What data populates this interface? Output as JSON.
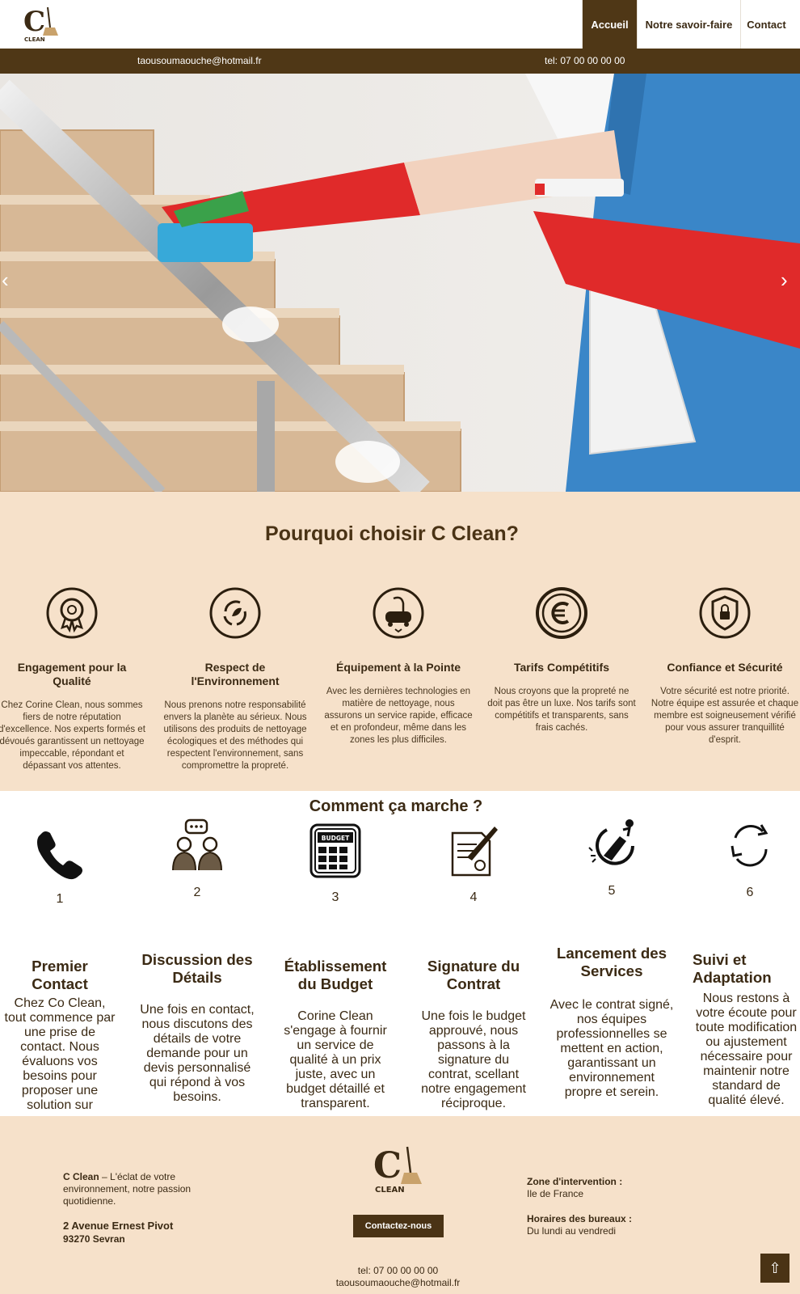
{
  "header": {
    "logo_text": "CLEAN",
    "nav": [
      {
        "label": "Accueil",
        "active": true
      },
      {
        "label": "Notre savoir-faire",
        "active": false
      },
      {
        "label": "Contact",
        "active": false
      }
    ],
    "email": "taousoumaouche@hotmail.fr",
    "phone": "tel: 07 00 00 00 00"
  },
  "hero": {
    "prev_arrow": "‹",
    "next_arrow": "›"
  },
  "why": {
    "title": "Pourquoi choisir C Clean?",
    "features": [
      {
        "icon": "award-medal-icon",
        "title": "Engagement pour la Qualité",
        "text": "Chez Corine Clean, nous sommes fiers de notre réputation d'excellence. Nos experts formés et dévoués garantissent un nettoyage impeccable, répondant et dépassant vos attentes."
      },
      {
        "icon": "recycle-leaf-icon",
        "title": "Respect de l'Environnement",
        "text": "Nous prenons notre responsabilité envers la planète au sérieux. Nous utilisons des produits de nettoyage écologiques et des méthodes qui respectent l'environnement, sans compromettre la propreté."
      },
      {
        "icon": "vacuum-cleaner-icon",
        "title": "Équipement à la Pointe",
        "text": "Avec les dernières technologies en matière de nettoyage, nous assurons un service rapide, efficace et en profondeur, même dans les zones les plus difficiles."
      },
      {
        "icon": "euro-coin-icon",
        "title": "Tarifs Compétitifs",
        "text": "Nous croyons que la propreté ne doit pas être un luxe. Nos tarifs sont compétitifs et transparents, sans frais cachés."
      },
      {
        "icon": "shield-lock-icon",
        "title": "Confiance et Sécurité",
        "text": "Votre sécurité est notre priorité. Notre équipe est assurée et chaque membre est soigneusement vérifié pour vous assurer tranquillité d'esprit."
      }
    ]
  },
  "how": {
    "title": "Comment ça marche ?",
    "steps": [
      {
        "icon": "phone-icon",
        "num": "1",
        "title": "Premier Contact",
        "text": "Chez Co Clean, tout commence par une prise de contact. Nous évaluons vos besoins pour proposer une solution sur mesure."
      },
      {
        "icon": "discussion-icon",
        "num": "2",
        "title": "Discussion des Détails",
        "text": "Une fois en contact, nous discutons des détails de votre demande pour un devis personnalisé qui répond à vos besoins."
      },
      {
        "icon": "budget-calculator-icon",
        "num": "3",
        "title": "Établissement du Budget",
        "text": "Corine Clean s'engage à fournir un service de qualité à un prix juste, avec un budget détaillé et transparent.",
        "icon_text": "BUDGET"
      },
      {
        "icon": "contract-signature-icon",
        "num": "4",
        "title": "Signature du Contrat",
        "text": "Une fois le budget approuvé, nous passons à la signature du contrat, scellant notre engagement réciproque."
      },
      {
        "icon": "cleaning-start-icon",
        "num": "5",
        "title": "Lancement des Services",
        "text": "Avec le contrat signé, nos équipes professionnelles se mettent en action, garantissant un environnement propre et serein."
      },
      {
        "icon": "cycle-arrows-icon",
        "num": "6",
        "title": "Suivi et Adaptation",
        "text": "Nous restons à votre écoute pour toute modification ou ajustement nécessaire pour maintenir notre standard de qualité élevé."
      }
    ]
  },
  "footer": {
    "brand": "C Clean",
    "tagline": " – L'éclat de votre environnement, notre passion quotidienne.",
    "street": "2 Avenue Ernest Pivot",
    "city": "93270 Sevran",
    "logo_text": "CLEAN",
    "contact_button": "Contactez-nous",
    "phone": "tel: 07 00 00 00 00",
    "email": "taousoumaouche@hotmail.fr",
    "zone_label": "Zone d'intervention :",
    "zone_value": "Ile de France",
    "hours_label": "Horaires des bureaux :",
    "hours_value": "Du lundi au vendredi",
    "back_to_top": "⇧"
  },
  "colors": {
    "brand_brown": "#4f3716",
    "section_beige": "#f6e1ca",
    "glove_red": "#e02a2a",
    "apron_blue": "#3a86c8"
  }
}
